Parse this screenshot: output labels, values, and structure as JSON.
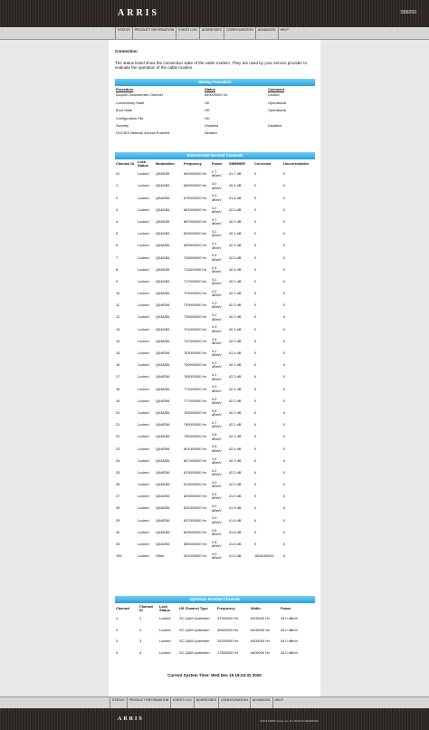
{
  "header": {
    "logo": "ARRIS",
    "model": "SB8200"
  },
  "nav": [
    "STATUS",
    "PRODUCT INFORMATION",
    "EVENT LOG",
    "ADDRESSES",
    "CONFIGURATION",
    "ADVANCED",
    "HELP"
  ],
  "section_title": "Connection",
  "intro": "The status listed show the connection state of the cable modem. They are used by your service provider to evaluate the operation of the cable modem.",
  "startup": {
    "title": "Startup Procedure",
    "headers": [
      "Procedure",
      "Status",
      "Comment"
    ],
    "rows": [
      [
        "Acquire Downstream Channel",
        "849000000 Hz",
        "Locked"
      ],
      [
        "Connectivity State",
        "OK",
        "Operational"
      ],
      [
        "Boot State",
        "OK",
        "Operational"
      ],
      [
        "Configuration File",
        "OK",
        ""
      ],
      [
        "Security",
        "Disabled",
        "Disabled"
      ],
      [
        "DOCSIS Network Access Enabled",
        "Allowed",
        ""
      ]
    ]
  },
  "downstream": {
    "title": "Downstream Bonded Channels",
    "headers": [
      "Channel ID",
      "Lock Status",
      "Modulation",
      "Frequency",
      "Power",
      "SNR/MER",
      "Corrected",
      "Uncorrectables"
    ],
    "rows": [
      [
        "31",
        "Locked",
        "QAM256",
        "849000000 Hz",
        "2.7 dBmV",
        "41.7 dB",
        "0",
        "0"
      ],
      [
        "1",
        "Locked",
        "QAM256",
        "669000000 Hz",
        "4.0 dBmV",
        "42.4 dB",
        "0",
        "0"
      ],
      [
        "2",
        "Locked",
        "QAM256",
        "675000000 Hz",
        "4.0 dBmV",
        "41.4 dB",
        "0",
        "0"
      ],
      [
        "3",
        "Locked",
        "QAM256",
        "681000000 Hz",
        "4.2 dBmV",
        "42.5 dB",
        "0",
        "0"
      ],
      [
        "4",
        "Locked",
        "QAM256",
        "687000000 Hz",
        "3.7 dBmV",
        "42.2 dB",
        "0",
        "0"
      ],
      [
        "5",
        "Locked",
        "QAM256",
        "693000000 Hz",
        "4.1 dBmV",
        "42.2 dB",
        "0",
        "0"
      ],
      [
        "6",
        "Locked",
        "QAM256",
        "699000000 Hz",
        "4.1 dBmV",
        "42.3 dB",
        "0",
        "0"
      ],
      [
        "7",
        "Locked",
        "QAM256",
        "705000000 Hz",
        "4.4 dBmV",
        "42.5 dB",
        "0",
        "0"
      ],
      [
        "8",
        "Locked",
        "QAM256",
        "711000000 Hz",
        "4.4 dBmV",
        "42.4 dB",
        "0",
        "0"
      ],
      [
        "9",
        "Locked",
        "QAM256",
        "717000000 Hz",
        "4.1 dBmV",
        "42.0 dB",
        "0",
        "0"
      ],
      [
        "10",
        "Locked",
        "QAM256",
        "723000000 Hz",
        "4.2 dBmV",
        "42.2 dB",
        "0",
        "0"
      ],
      [
        "11",
        "Locked",
        "QAM256",
        "729000000 Hz",
        "4.3 dBmV",
        "42.3 dB",
        "0",
        "0"
      ],
      [
        "12",
        "Locked",
        "QAM256",
        "735000000 Hz",
        "4.2 dBmV",
        "42.2 dB",
        "0",
        "0"
      ],
      [
        "13",
        "Locked",
        "QAM256",
        "741000000 Hz",
        "4.3 dBmV",
        "42.3 dB",
        "0",
        "0"
      ],
      [
        "14",
        "Locked",
        "QAM256",
        "747000000 Hz",
        "4.4 dBmV",
        "42.0 dB",
        "0",
        "0"
      ],
      [
        "15",
        "Locked",
        "QAM256",
        "753000000 Hz",
        "4.1 dBmV",
        "41.4 dB",
        "0",
        "0"
      ],
      [
        "16",
        "Locked",
        "QAM256",
        "759000000 Hz",
        "4.3 dBmV",
        "42.1 dB",
        "0",
        "0"
      ],
      [
        "17",
        "Locked",
        "QAM256",
        "765000000 Hz",
        "4.1 dBmV",
        "42.3 dB",
        "0",
        "0"
      ],
      [
        "18",
        "Locked",
        "QAM256",
        "771000000 Hz",
        "4.9 dBmV",
        "42.4 dB",
        "0",
        "0"
      ],
      [
        "19",
        "Locked",
        "QAM256",
        "777000000 Hz",
        "4.9 dBmV",
        "42.2 dB",
        "0",
        "0"
      ],
      [
        "20",
        "Locked",
        "QAM256",
        "783000000 Hz",
        "4.8 dBmV",
        "42.2 dB",
        "0",
        "0"
      ],
      [
        "21",
        "Locked",
        "QAM256",
        "789000000 Hz",
        "4.7 dBmV",
        "42.1 dB",
        "0",
        "0"
      ],
      [
        "22",
        "Locked",
        "QAM256",
        "795000000 Hz",
        "4.8 dBmV",
        "42.2 dB",
        "0",
        "0"
      ],
      [
        "23",
        "Locked",
        "QAM256",
        "801000000 Hz",
        "4.8 dBmV",
        "42.4 dB",
        "0",
        "0"
      ],
      [
        "24",
        "Locked",
        "QAM256",
        "807000000 Hz",
        "4.4 dBmV",
        "42.3 dB",
        "0",
        "0"
      ],
      [
        "25",
        "Locked",
        "QAM256",
        "813000000 Hz",
        "4.2 dBmV",
        "42.2 dB",
        "0",
        "0"
      ],
      [
        "26",
        "Locked",
        "QAM256",
        "819000000 Hz",
        "4.0 dBmV",
        "42.0 dB",
        "0",
        "0"
      ],
      [
        "27",
        "Locked",
        "QAM256",
        "825000000 Hz",
        "3.4 dBmV",
        "41.9 dB",
        "0",
        "0"
      ],
      [
        "28",
        "Locked",
        "QAM256",
        "831000000 Hz",
        "3.0 dBmV",
        "41.9 dB",
        "0",
        "0"
      ],
      [
        "29",
        "Locked",
        "QAM256",
        "837000000 Hz",
        "3.0 dBmV",
        "41.6 dB",
        "0",
        "0"
      ],
      [
        "30",
        "Locked",
        "QAM256",
        "843000000 Hz",
        "2.6 dBmV",
        "41.8 dB",
        "0",
        "0"
      ],
      [
        "33",
        "Locked",
        "QAM256",
        "855000000 Hz",
        "2.8 dBmV",
        "41.8 dB",
        "0",
        "0"
      ],
      [
        "159",
        "Locked",
        "Other",
        "591000000 Hz",
        "4.0 dBmV",
        "41.0 dB",
        "1806160200",
        "5"
      ]
    ]
  },
  "upstream": {
    "title": "Upstream Bonded Channels",
    "headers": [
      "Channel",
      "Channel ID",
      "Lock Status",
      "US Channel Type",
      "Frequency",
      "Width",
      "Power"
    ],
    "rows": [
      [
        "1",
        "1",
        "Locked",
        "SC-QAM Upstream",
        "37000000 Hz",
        "6400000 Hz",
        "43.0 dBmV"
      ],
      [
        "2",
        "2",
        "Locked",
        "SC-QAM Upstream",
        "30600000 Hz",
        "6400000 Hz",
        "44.0 dBmV"
      ],
      [
        "3",
        "3",
        "Locked",
        "SC-QAM Upstream",
        "24200000 Hz",
        "6400000 Hz",
        "44.0 dBmV"
      ],
      [
        "4",
        "4",
        "Locked",
        "SC-QAM Upstream",
        "17800000 Hz",
        "6400000 Hz",
        "43.0 dBmV"
      ]
    ]
  },
  "system_time": "Current System Time: Wed Dec 16 19:24:32 2020",
  "footer": {
    "logo": "ARRIS",
    "copyright": "©2018 ARRIS Group, Inc. ALL RIGHTS RESERVED"
  }
}
